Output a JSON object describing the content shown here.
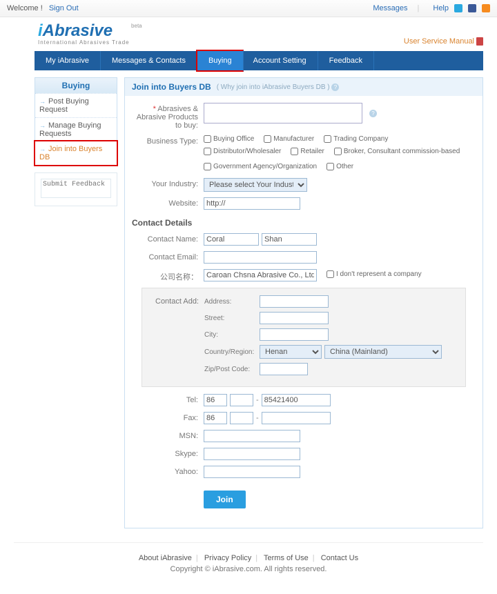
{
  "topbar": {
    "welcome": "Welcome !",
    "signout": "Sign Out",
    "messages": "Messages",
    "help": "Help"
  },
  "brand": {
    "logo": "iAbrasive",
    "tagline": "International Abrasives Trade",
    "beta": "beta",
    "manual": "User Service Manual"
  },
  "nav": {
    "my": "My iAbrasive",
    "msg": "Messages & Contacts",
    "buying": "Buying",
    "acct": "Account Setting",
    "fb": "Feedback"
  },
  "sidebar": {
    "title": "Buying",
    "items": [
      "Post Buying Request",
      "Manage Buying Requests",
      "Join into Buyers DB"
    ],
    "feedback_ph": "Submit Feedback"
  },
  "head": {
    "title": "Join into Buyers DB",
    "why": "( Why join into iAbrasive Buyers DB       )"
  },
  "form": {
    "products_lbl1": "Abrasives &",
    "products_lbl2": "Abrasive Products to buy:",
    "biztype_lbl": "Business Type:",
    "biztypes": [
      "Buying Office",
      "Manufacturer",
      "Trading Company",
      "Distributor/Wholesaler",
      "Retailer",
      "Broker, Consultant commission-based",
      "Government Agency/Organization",
      "Other"
    ],
    "industry_lbl": "Your Industry:",
    "industry_sel": "Please select Your Industry",
    "website_lbl": "Website:",
    "website_val": "http://"
  },
  "contact": {
    "heading": "Contact Details",
    "name_lbl": "Contact Name:",
    "first": "Coral",
    "last": "Shan",
    "email_lbl": "Contact Email:",
    "company_lbl": "公司名称：",
    "company_val": "Caroan Chsna Abrasive Co., Ltd.",
    "norep": "I don't represent a company",
    "addr_lbl": "Contact Add:",
    "address": "Address:",
    "street": "Street:",
    "city": "City:",
    "region_lbl": "Country/Region:",
    "province": "Henan",
    "country": "China (Mainland)",
    "zip_lbl": "Zip/Post Code:",
    "tel_lbl": "Tel:",
    "fax_lbl": "Fax:",
    "tel_cc": "86",
    "tel_num": "85421400",
    "fax_cc": "86",
    "msn_lbl": "MSN:",
    "skype_lbl": "Skype:",
    "yahoo_lbl": "Yahoo:",
    "join_btn": "Join"
  },
  "footer": {
    "about": "About iAbrasive",
    "privacy": "Privacy Policy",
    "terms": "Terms of Use",
    "contact": "Contact Us",
    "copy": "Copyright © iAbrasive.com. All rights reserved."
  }
}
